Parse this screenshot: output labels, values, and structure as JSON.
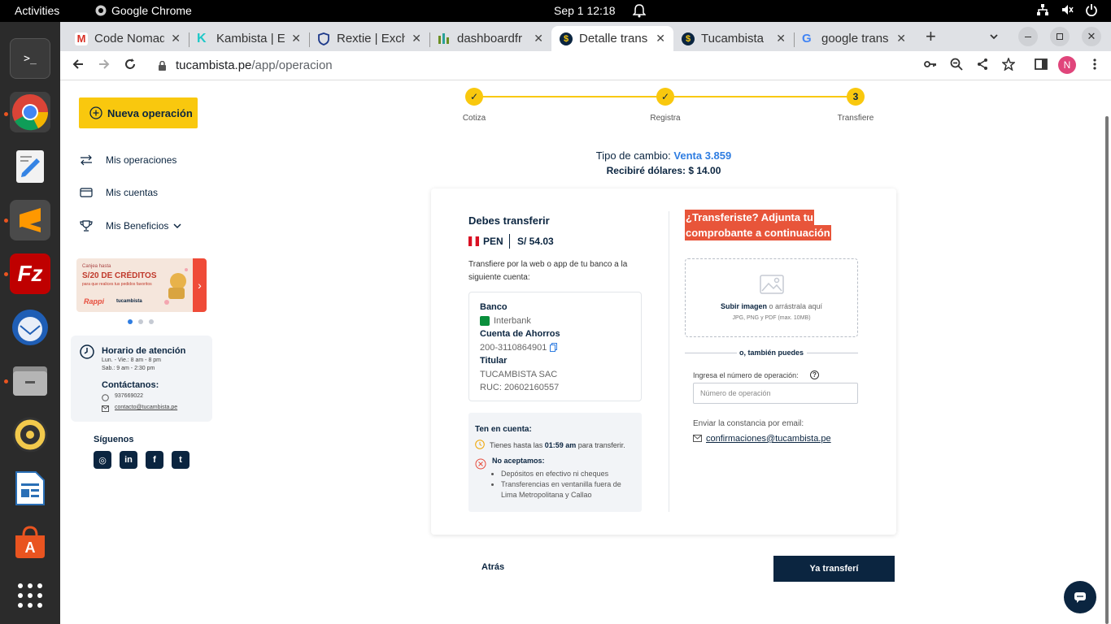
{
  "topbar": {
    "activities": "Activities",
    "app_name": "Google Chrome",
    "clock": "Sep 1  12:18"
  },
  "dock": {
    "items": [
      "terminal-icon",
      "chrome-icon",
      "text-editor-icon",
      "sublime-icon",
      "filezilla-icon",
      "thunderbird-icon",
      "files-icon",
      "rhythmbox-icon",
      "libreoffice-writer-icon",
      "app-center-icon",
      "show-apps-icon"
    ]
  },
  "browser": {
    "tabs": [
      {
        "title": "Code Nomad",
        "favicon_color": "#d93025",
        "close": "✕"
      },
      {
        "title": "Kambista | E",
        "favicon_color": "#1ec8c8",
        "close": "✕"
      },
      {
        "title": "Rextie | Exch",
        "favicon_color": "#1e3a8a",
        "close": "✕"
      },
      {
        "title": "dashboardfr",
        "favicon_color": "#6b8e23",
        "close": "✕"
      },
      {
        "title": "Detalle trans",
        "favicon_color": "#0b2540",
        "close": "✕"
      },
      {
        "title": "Tucambista",
        "favicon_color": "#0b2540",
        "close": "✕"
      },
      {
        "title": "google trans",
        "favicon_color": "#4285f4",
        "close": "✕"
      }
    ],
    "new_tab": "+",
    "url_host": "tucambista.pe",
    "url_path": "/app/operacion",
    "profile_initial": "N"
  },
  "sidebar": {
    "new_op_label": "Nueva operación",
    "nav": [
      {
        "label": "Mis operaciones"
      },
      {
        "label": "Mis cuentas"
      },
      {
        "label": "Mis Beneficios"
      }
    ],
    "promo": {
      "line1": "Canjea hasta",
      "line2": "S/20 DE CRÉDITOS",
      "line3": "para que realices tus pedidos favoritos",
      "brand1": "Rappi",
      "brand2": "tucambista"
    },
    "hours_title": "Horario de atención",
    "hours_line1": "Lun. - Vie.: 8 am - 8 pm",
    "hours_line2": "Sab.: 9 am - 2:30 pm",
    "contact_title": "Contáctanos:",
    "phone": "937669022",
    "email": "contacto@tucambista.pe",
    "follow": "Síguenos",
    "social": [
      "instagram-icon",
      "linkedin-icon",
      "facebook-icon",
      "twitter-icon"
    ]
  },
  "stepper": {
    "steps": [
      {
        "label": "Cotiza",
        "mark": "✓"
      },
      {
        "label": "Registra",
        "mark": "✓"
      },
      {
        "label": "Transfiere",
        "mark": "3"
      }
    ]
  },
  "rate": {
    "label": "Tipo de cambio:",
    "value": "Venta 3.859",
    "receive": "Recibiré dólares: $ 14.00"
  },
  "transfer": {
    "title": "Debes transferir",
    "currency": "PEN",
    "amount": "S/ 54.03",
    "instructions": "Transfiere por la web o app de tu banco a la siguiente cuenta:",
    "bank_label": "Banco",
    "bank_value": "Interbank",
    "account_label": "Cuenta de Ahorros",
    "account_value": "200-3110864901",
    "holder_label": "Titular",
    "holder_value": "TUCAMBISTA SAC",
    "ruc_value": "RUC: 20602160557"
  },
  "notice": {
    "title": "Ten en cuenta:",
    "deadline_prefix": "Tienes hasta las",
    "deadline_time": "01:59 am",
    "deadline_suffix": "para transferir.",
    "no_accept": "No aceptamos:",
    "items": [
      "Depósitos en efectivo ni cheques",
      "Transferencias en ventanilla fuera de Lima Metropolitana y Callao"
    ]
  },
  "proof": {
    "heading_l1": "¿Transferiste? Adjunta tu",
    "heading_l2": "comprobante a continuación",
    "upload_link": "Subir imagen",
    "upload_rest": "o arrástrala aquí",
    "upload_hint": "JPG, PNG y PDF (max. 10MB)",
    "or_text": "o, también puedes",
    "op_label": "Ingresa el número de operación:",
    "op_placeholder": "Número de operación",
    "email_label": "Enviar la constancia por email:",
    "email_value": "confirmaciones@tucambista.pe"
  },
  "actions": {
    "back": "Atrás",
    "done": "Ya transferí"
  }
}
